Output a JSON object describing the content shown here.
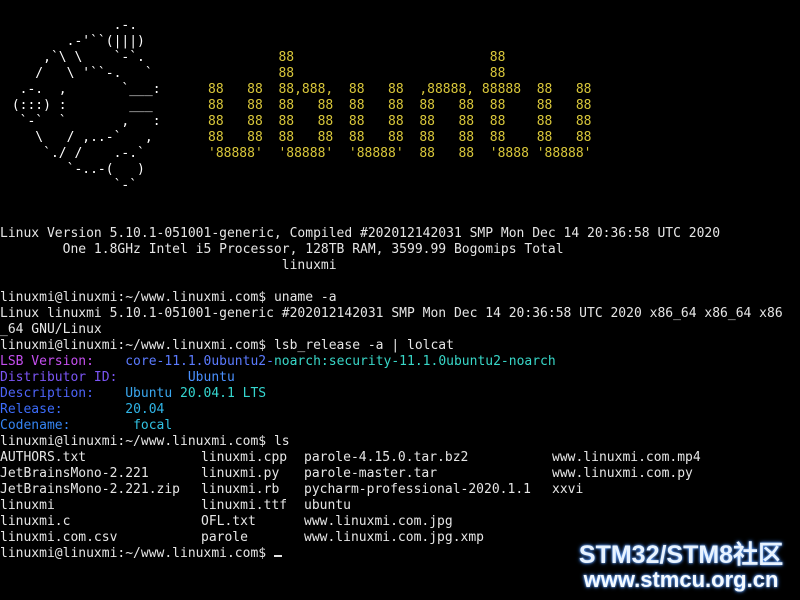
{
  "banner": {
    "tux_lines": [
      "              .-.",
      "        .-'``(|||)",
      "     ,`\\ \\    `-`.",
      "    /   \\ '``-.   `",
      "  .-.  ,       `___:",
      " (:::) :        ___",
      "  `-`  `       ,   :",
      "    \\   / ,..-`   ,",
      "     `./ /    .-.`",
      "        `-..-(   )",
      "              `-`"
    ],
    "ascii_lines": [
      "         88                         88",
      "         88                         88",
      "88   88  88,888,  88   88  ,88888, 88888  88   88",
      "88   88  88   88  88   88  88   88  88    88   88",
      "88   88  88   88  88   88  88   88  88    88   88",
      "88   88  88   88  88   88  88   88  88    88   88",
      "'88888'  '88888'  '88888'  88   88  '8888 '88888'"
    ],
    "info_line1": "Linux Version 5.10.1-051001-generic, Compiled #202012142031 SMP Mon Dec 14 20:36:58 UTC 2020",
    "info_line2": "        One 1.8GHz Intel i5 Processor, 128TB RAM, 3599.99 Bogomips Total",
    "hostname": "                                    linuxmi"
  },
  "session": {
    "prompt": "linuxmi@linuxmi:~/www.linuxmi.com$ ",
    "cmd1": "uname -a",
    "out1_a": "Linux linuxmi 5.10.1-051001-generic #202012142031 SMP Mon Dec 14 20:36:58 UTC 2020 x86_64 x86_64 x86",
    "out1_b": "_64 GNU/Linux",
    "cmd2": "lsb_release -a | lolcat",
    "lsb": [
      {
        "k": "LSB Version:",
        "v": "core-11.1.0ubuntu2-noarch:security-11.1.0ubuntu2-noarch",
        "kc": "#c54ff0",
        "vc1": "#5b7bff",
        "vc2": "#38d7c8"
      },
      {
        "k": "Distributor ID:",
        "v": "Ubuntu",
        "kc": "#7b55f5",
        "vc1": "#4a90ff",
        "vc2": "#4a90ff"
      },
      {
        "k": "Description:",
        "v": "Ubuntu 20.04.1 LTS",
        "kc": "#4d63f7",
        "vc1": "#3aa8f0",
        "vc2": "#35d6cf"
      },
      {
        "k": "Release:",
        "v": "20.04",
        "kc": "#3c6cfb",
        "vc1": "#2fb4e6",
        "vc2": "#2fb4e6"
      },
      {
        "k": "Codename:",
        "v": "focal",
        "kc": "#3585f3",
        "vc1": "#31c2e2",
        "vc2": "#31c2e2"
      }
    ],
    "cmd3": "ls",
    "ls_col1": [
      "AUTHORS.txt",
      "JetBrainsMono-2.221",
      "JetBrainsMono-2.221.zip",
      "linuxmi",
      "linuxmi.c",
      "linuxmi.com.csv"
    ],
    "ls_col2": [
      "linuxmi.cpp",
      "linuxmi.py",
      "linuxmi.rb",
      "linuxmi.ttf",
      "OFL.txt",
      "parole"
    ],
    "ls_col3": [
      "parole-4.15.0.tar.bz2",
      "parole-master.tar",
      "pycharm-professional-2020.1.1",
      "ubuntu",
      "www.linuxmi.com.jpg",
      "www.linuxmi.com.jpg.xmp"
    ],
    "ls_col4": [
      "www.linuxmi.com.mp4",
      "www.linuxmi.com.py",
      "xxvi"
    ]
  },
  "watermark": {
    "line1": "STM32/STM8社区",
    "line2": "www.stmcu.org.cn"
  }
}
